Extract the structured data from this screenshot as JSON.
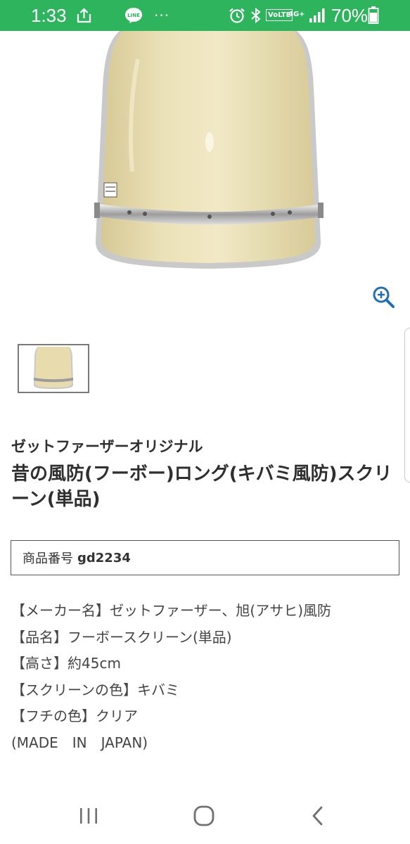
{
  "status_bar": {
    "time": "1:33",
    "battery": "70%",
    "dots": "···",
    "volte": "VoLTE",
    "network": "4G+"
  },
  "product": {
    "brand": "ゼットファーザーオリジナル",
    "title": "昔の風防(フーボー)ロング(キバミ風防)スクリーン(単品)",
    "number_label": "商品番号",
    "number_value": "gd2234",
    "description_lines": [
      "【メーカー名】ゼットファーザー、旭(アサヒ)風防",
      "【品名】フーボースクリーン(単品)",
      "【高さ】約45cm",
      "【スクリーンの色】キバミ",
      "【フチの色】クリア",
      "(MADE　IN　JAPAN)"
    ]
  },
  "colors": {
    "status_bar_bg": "#2fb45e",
    "accent_zoom": "#1f6fb2",
    "screen_tint": "#e8dcae"
  },
  "icons": {
    "zoom": "zoom-in-icon",
    "recents": "recent-apps-icon",
    "home": "home-icon",
    "back": "back-icon"
  }
}
